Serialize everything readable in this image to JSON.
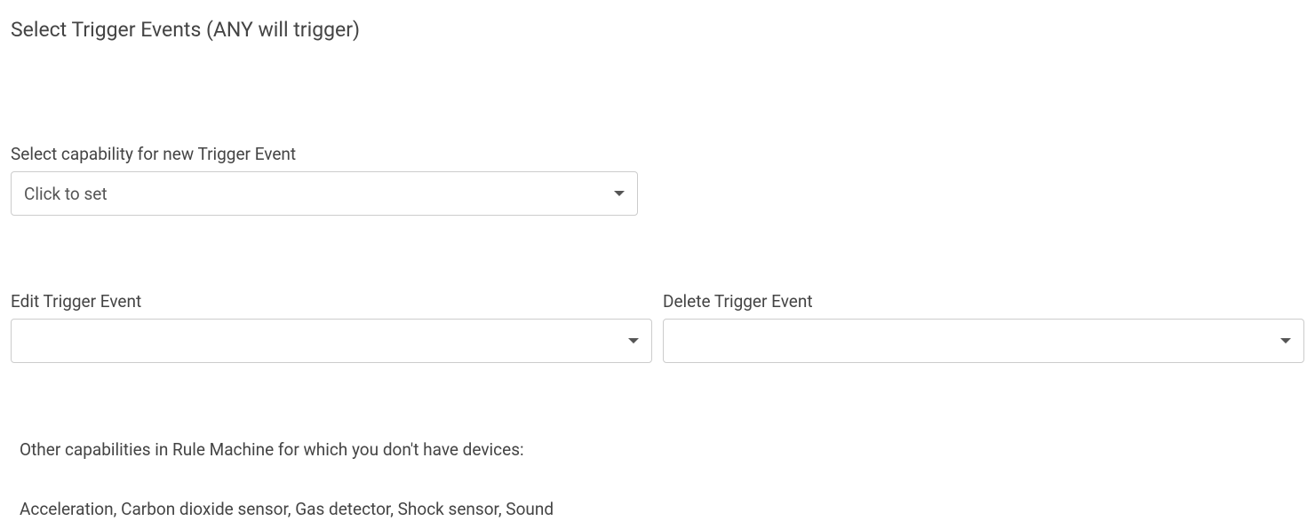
{
  "pageTitle": "Select Trigger Events (ANY will trigger)",
  "capabilitySelect": {
    "label": "Select capability for new Trigger Event",
    "placeholder": "Click to set"
  },
  "editTrigger": {
    "label": "Edit Trigger Event",
    "value": ""
  },
  "deleteTrigger": {
    "label": "Delete Trigger Event",
    "value": ""
  },
  "otherCapabilities": {
    "heading": "Other capabilities in Rule Machine for which you don't have devices:",
    "list": "Acceleration, Carbon dioxide sensor, Gas detector, Shock sensor, Sound"
  }
}
